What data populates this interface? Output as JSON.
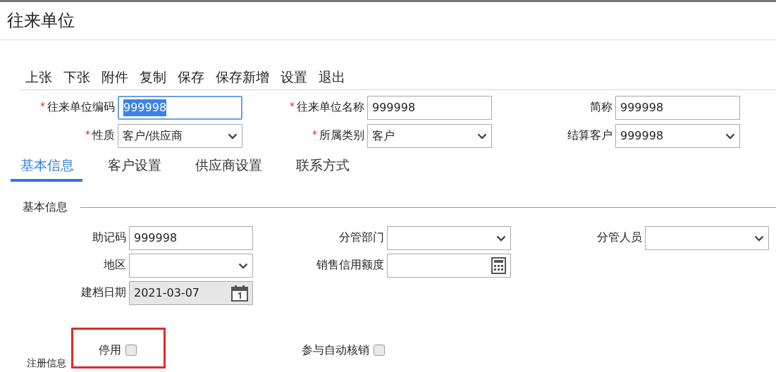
{
  "window": {
    "title": "往来单位"
  },
  "toolbar": [
    {
      "label": "上张"
    },
    {
      "label": "下张"
    },
    {
      "label": "附件"
    },
    {
      "label": "复制"
    },
    {
      "label": "保存"
    },
    {
      "label": "保存新增"
    },
    {
      "label": "设置"
    },
    {
      "label": "退出"
    }
  ],
  "header_fields": [
    {
      "label": "往来单位编码",
      "marker": "*",
      "kind": "input",
      "value": "999998",
      "focused": true
    },
    {
      "label": "往来单位名称",
      "marker": "*",
      "kind": "input",
      "value": "999998",
      "focused": false
    },
    {
      "label": "简称",
      "kind": "input",
      "value": "999998",
      "focused": false
    },
    {
      "label": "性质",
      "marker": "*",
      "kind": "select",
      "value": "客户/供应商",
      "focused": false
    },
    {
      "label": "所属类别",
      "marker": "*",
      "kind": "select",
      "value": "客户",
      "focused": false
    },
    {
      "label": "结算客户",
      "kind": "select",
      "value": "999998",
      "focused": false
    }
  ],
  "tabs": [
    {
      "label": "基本信息",
      "selected": true
    },
    {
      "label": "客户设置",
      "selected": false
    },
    {
      "label": "供应商设置",
      "selected": false
    },
    {
      "label": "联系方式",
      "selected": false
    }
  ],
  "section": {
    "title": "基本信息"
  },
  "fields": [
    {
      "label": "助记码",
      "kind": "input",
      "value": "999998",
      "disabled": false
    },
    {
      "label": "分管部门",
      "kind": "select",
      "disabled": false
    },
    {
      "label": "分管人员",
      "kind": "select",
      "disabled": false
    },
    {
      "label": "地区",
      "kind": "select",
      "disabled": false
    },
    {
      "label": "销售信用额度",
      "kind": "amount",
      "disabled": false
    },
    {
      "kind": "spacer"
    },
    {
      "label": "建档日期",
      "kind": "date",
      "value": "2021-03-07",
      "disabled": true
    }
  ],
  "checkboxes": [
    {
      "label": "停用",
      "checked": false,
      "highlighted": true
    },
    {
      "label": "参与自动核销",
      "checked": false,
      "highlighted": false
    }
  ],
  "next_section": {
    "title": "注册信息"
  }
}
